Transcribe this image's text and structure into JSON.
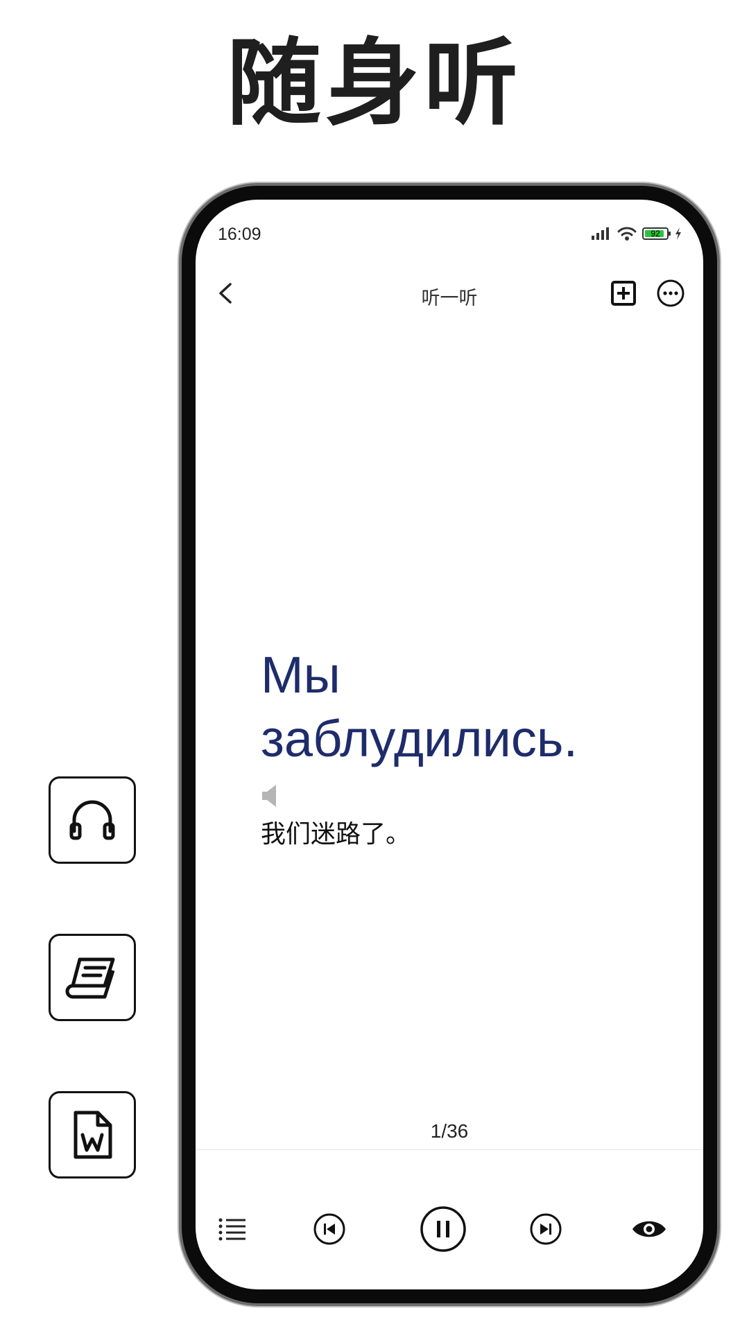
{
  "headline": "随身听",
  "side_icons": [
    "headphones-icon",
    "book-icon",
    "word-document-icon"
  ],
  "status_bar": {
    "time": "16:09",
    "battery": "92"
  },
  "navbar": {
    "title": "听一听"
  },
  "card": {
    "foreign_line1": "Мы",
    "foreign_line2": "заблудились.",
    "translation": "我们迷路了。"
  },
  "progress": "1/36",
  "colors": {
    "foreign_text": "#1e2c6b",
    "battery_fill": "#2bc33a"
  },
  "controls": [
    "list-icon",
    "previous-icon",
    "pause-icon",
    "next-icon",
    "eye-icon"
  ]
}
